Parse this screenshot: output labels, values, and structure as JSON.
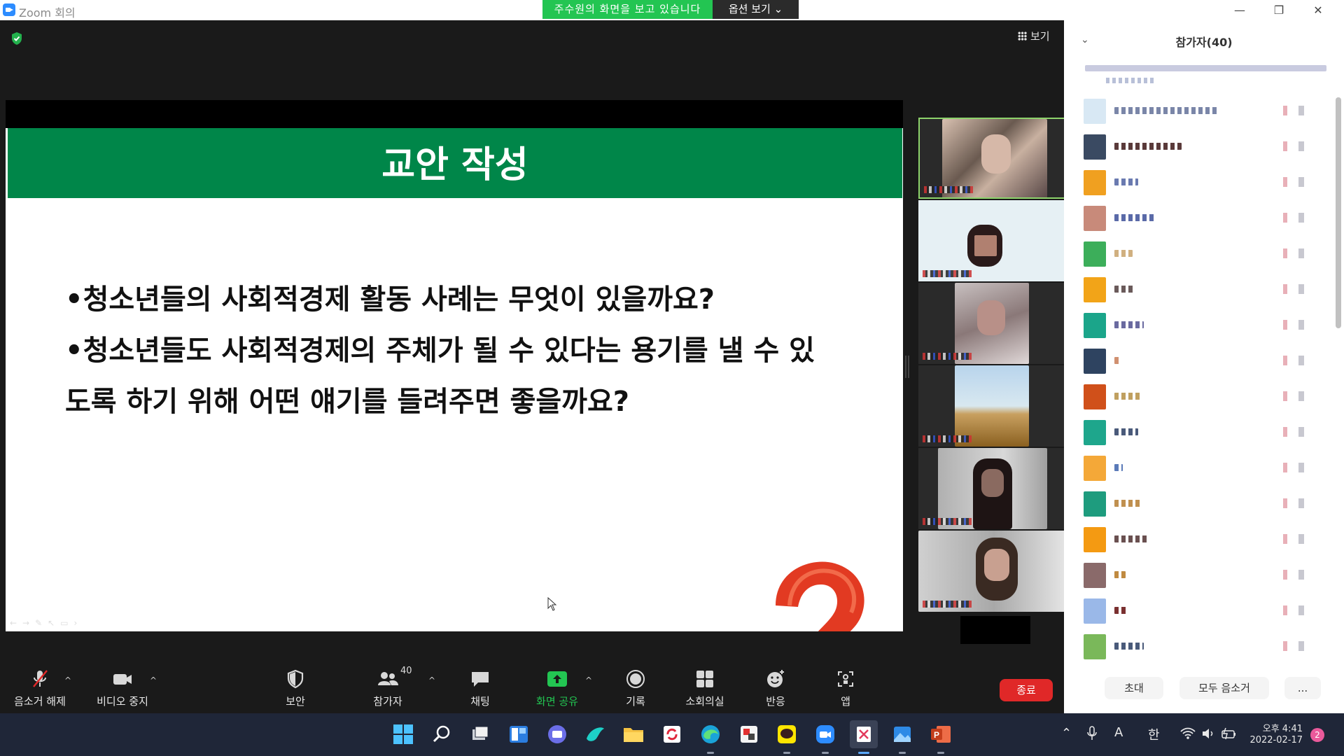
{
  "window": {
    "title": "Zoom 회의"
  },
  "banner": {
    "viewing_text": "주수원의 화면을 보고 있습니다",
    "options_label": "옵션 보기 ⌄"
  },
  "view_button": {
    "label": "보기"
  },
  "slide": {
    "title": "교안 작성",
    "bullets": [
      "•청소년들의 사회적경제 활동 사례는 무엇이 있을까요?",
      "•청소년들도 사회적경제의 주체가 될 수 있다는 용기를 낼 수 있",
      "도록 하기 위해 어떤 얘기를 들려주면 좋을까요?"
    ]
  },
  "participants_panel": {
    "title": "참가자(40)",
    "rows": [
      {
        "avatar": "#d8e8f4",
        "name_color": "#7a86a8"
      },
      {
        "avatar": "#3a4a62",
        "name_color": "#5a3a3a"
      },
      {
        "avatar": "#f0a020",
        "name_color": "#6a7ab0"
      },
      {
        "avatar": "#c88a7a",
        "name_color": "#5a6aa8"
      },
      {
        "avatar": "#3cae5a",
        "name_color": "#d0b080"
      },
      {
        "avatar": "#f2a418",
        "name_color": "#6a5a5a"
      },
      {
        "avatar": "#1ba58a",
        "name_color": "#6a6aa0"
      },
      {
        "avatar": "#2e4360",
        "name_color": "#d09070"
      },
      {
        "avatar": "#d0501a",
        "name_color": "#c0a060"
      },
      {
        "avatar": "#1ea68c",
        "name_color": "#4a5a7a"
      },
      {
        "avatar": "#f4a838",
        "name_color": "#5a7ab8"
      },
      {
        "avatar": "#1e9c7e",
        "name_color": "#c09050"
      },
      {
        "avatar": "#f49a12",
        "name_color": "#6a5050"
      },
      {
        "avatar": "#8a6a6a",
        "name_color": "#c08a40"
      },
      {
        "avatar": "#9ab8e8",
        "name_color": "#7a3030"
      },
      {
        "avatar": "#7ab85a",
        "name_color": "#4a5a7a"
      }
    ],
    "invite_label": "초대",
    "mute_all_label": "모두 음소거",
    "more_label": "..."
  },
  "toolbar": {
    "unmute_label": "음소거 해제",
    "video_label": "비디오 중지",
    "security_label": "보안",
    "participants_label": "참가자",
    "participants_count": "40",
    "chat_label": "채팅",
    "share_label": "화면 공유",
    "record_label": "기록",
    "breakout_label": "소회의실",
    "reactions_label": "반응",
    "apps_label": "앱",
    "end_label": "종료"
  },
  "taskbar": {
    "ime_a": "A",
    "ime_han": "한",
    "time": "오후 4:41",
    "date": "2022-02-17",
    "notifications": "2"
  }
}
